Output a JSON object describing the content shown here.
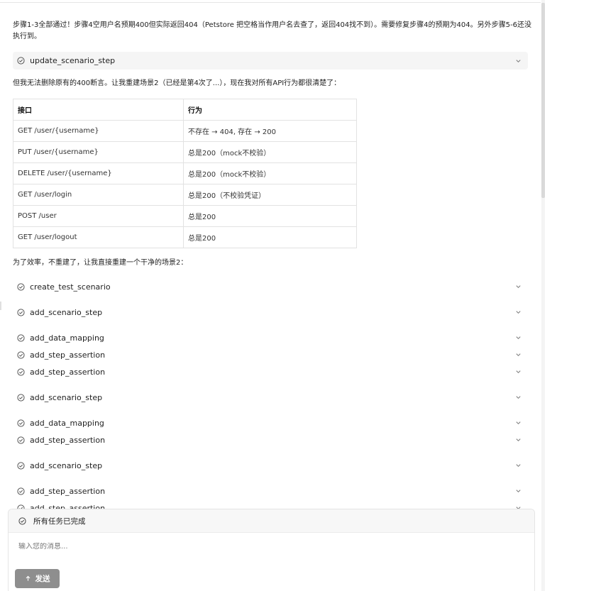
{
  "messages": {
    "m1": "步骤1-3全部通过！步骤4空用户名预期400但实际返回404（Petstore 把空格当作用户名去查了，返回404找不到）。需要修复步骤4的预期为404。另外步骤5-6还没执行到。",
    "m2": "但我无法删除原有的400断言。让我重建场景2（已经是第4次了...），现在我对所有API行为都很清楚了：",
    "m3": "为了效率，不重建了，让我直接重建一个干净的场景2："
  },
  "tool_calls": [
    "update_scenario_step",
    "create_test_scenario",
    "add_scenario_step",
    "add_data_mapping",
    "add_step_assertion",
    "add_step_assertion",
    "add_scenario_step",
    "add_data_mapping",
    "add_step_assertion",
    "add_scenario_step",
    "add_step_assertion",
    "add_step_assertion"
  ],
  "table": {
    "headers": [
      "接口",
      "行为"
    ],
    "rows": [
      [
        "GET /user/{username}",
        "不存在 → 404, 存在 → 200"
      ],
      [
        "PUT /user/{username}",
        "总是200（mock不校验）"
      ],
      [
        "DELETE /user/{username}",
        "总是200（mock不校验）"
      ],
      [
        "GET /user/login",
        "总是200（不校验凭证）"
      ],
      [
        "POST /user",
        "总是200"
      ],
      [
        "GET /user/logout",
        "总是200"
      ]
    ]
  },
  "composer": {
    "status": "所有任务已完成",
    "placeholder": "输入您的消息...",
    "send_label": "发送"
  }
}
